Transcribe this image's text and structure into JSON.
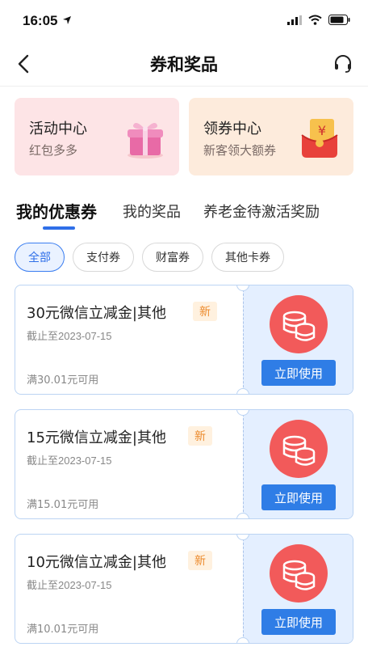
{
  "status": {
    "time": "16:05"
  },
  "nav": {
    "title": "券和奖品"
  },
  "promos": [
    {
      "title": "活动中心",
      "subtitle": "红包多多"
    },
    {
      "title": "领券中心",
      "subtitle": "新客领大额券"
    }
  ],
  "tabs": [
    "我的优惠券",
    "我的奖品",
    "养老金待激活奖励"
  ],
  "filters": [
    "全部",
    "支付券",
    "财富券",
    "其他卡券"
  ],
  "coupons": [
    {
      "title": "30元微信立减金|其他",
      "badge": "新",
      "expiry": "截止至2023-07-15",
      "min": "满30.01元可用",
      "button": "立即使用"
    },
    {
      "title": "15元微信立减金|其他",
      "badge": "新",
      "expiry": "截止至2023-07-15",
      "min": "满15.01元可用",
      "button": "立即使用"
    },
    {
      "title": "10元微信立减金|其他",
      "badge": "新",
      "expiry": "截止至2023-07-15",
      "min": "满10.01元可用",
      "button": "立即使用"
    }
  ],
  "colors": {
    "accent": "#2f6fe8",
    "button": "#2f7de6",
    "coin": "#f25a5a",
    "badge_text": "#ec8a2c"
  },
  "icons": {
    "back": "back-arrow-icon",
    "service": "headset-icon",
    "coin": "coin-stack-icon",
    "gift": "gift-box-icon",
    "red_envelope": "red-envelope-icon"
  }
}
